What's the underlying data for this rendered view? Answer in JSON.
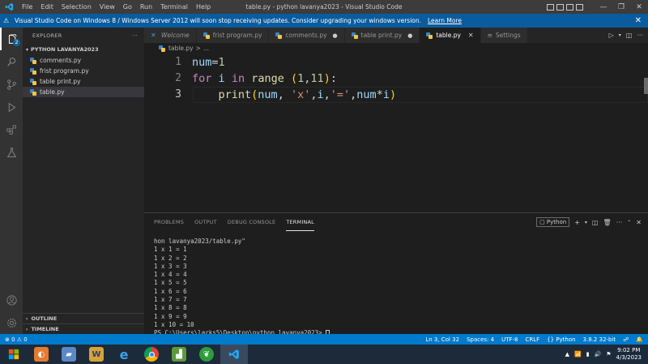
{
  "titlebar": {
    "menu": [
      "File",
      "Edit",
      "Selection",
      "View",
      "Go",
      "Run",
      "Terminal",
      "Help"
    ],
    "title": "table.py - python lavanya2023 - Visual Studio Code",
    "minimize": "—",
    "restore": "❐",
    "close": "✕"
  },
  "banner": {
    "message": "Visual Studio Code on Windows 8 / Windows Server 2012 will soon stop receiving updates. Consider upgrading your windows version.",
    "link": "Learn More",
    "close": "✕"
  },
  "activity": {
    "badge": "2"
  },
  "sidebar": {
    "header": "EXPLORER",
    "more": "···",
    "folder": "PYTHON LAVANYA2023",
    "files": [
      "comments.py",
      "frist program.py",
      "table print.py",
      "table.py"
    ],
    "sections": [
      "OUTLINE",
      "TIMELINE"
    ]
  },
  "tabs": {
    "items": [
      {
        "label": "Welcome"
      },
      {
        "label": "frist program.py"
      },
      {
        "label": "comments.py"
      },
      {
        "label": "table print.py"
      },
      {
        "label": "table.py"
      },
      {
        "label": "Settings"
      }
    ],
    "dot": "●",
    "close": "✕"
  },
  "breadcrumb": {
    "file": "table.py",
    "sep": ">",
    "more": "..."
  },
  "editor": {
    "line_numbers": [
      "1",
      "2",
      "3"
    ]
  },
  "panel": {
    "tabs": [
      "PROBLEMS",
      "OUTPUT",
      "DEBUG CONSOLE",
      "TERMINAL"
    ],
    "terminal_label": "Python",
    "terminal_lines": [
      "hon lavanya2023/table.py\"",
      "1 x 1 = 1",
      "1 x 2 = 2",
      "1 x 3 = 3",
      "1 x 4 = 4",
      "1 x 5 = 5",
      "1 x 6 = 6",
      "1 x 7 = 7",
      "1 x 8 = 8",
      "1 x 9 = 9",
      "1 x 10 = 10"
    ],
    "prompt": "PS C:\\Users\\larks5\\Desktop\\python lavanya2023> "
  },
  "statusbar": {
    "problems": "⊗ 0 ⚠ 0",
    "position": "Ln 3, Col 32",
    "spaces": "Spaces: 4",
    "encoding": "UTF-8",
    "eol": "CRLF",
    "language": "Python",
    "interpreter": "3.8.2 32-bit"
  },
  "taskbar": {
    "time": "9:02 PM",
    "date": "4/3/2023"
  },
  "colors": {
    "accent": "#007acc",
    "banner": "#0a5c9e",
    "keyword": "#c586c0",
    "function": "#dcdcaa",
    "variable": "#9cdcfe",
    "number": "#b5cea8",
    "string": "#ce9178"
  }
}
